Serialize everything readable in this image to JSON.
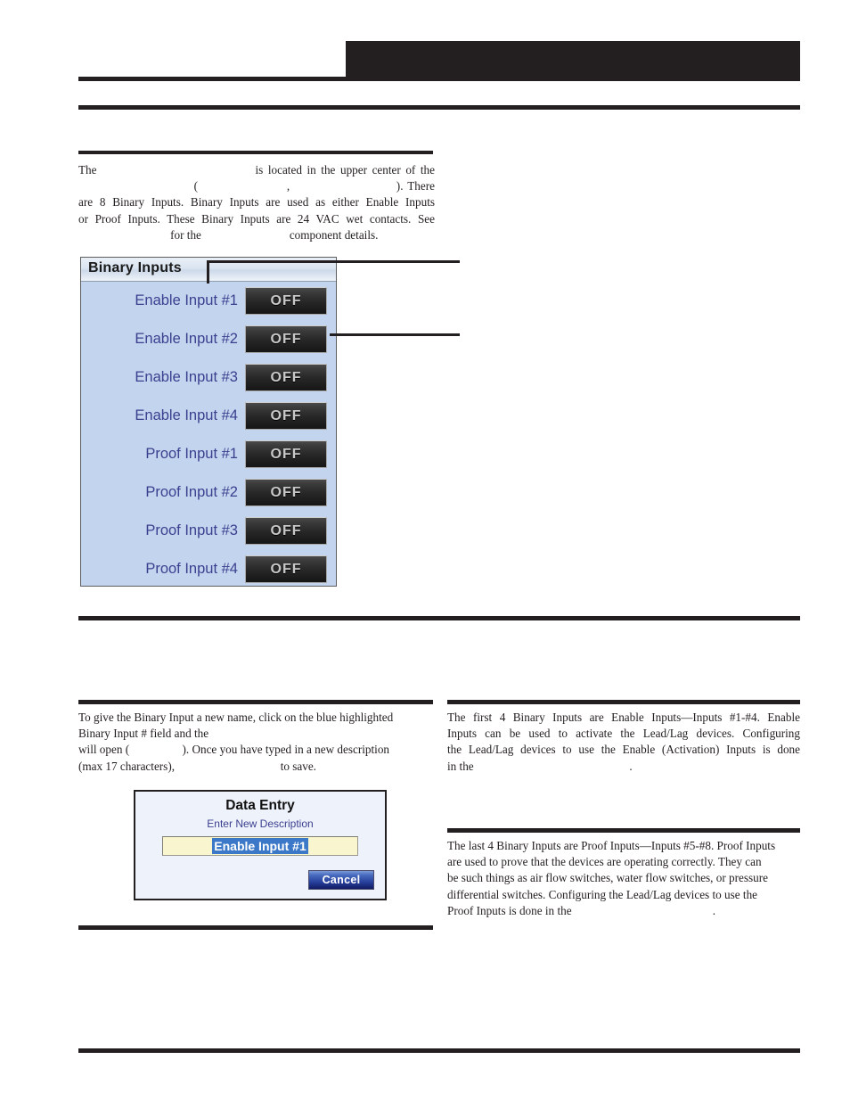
{
  "document": {
    "header": {
      "banner_block": "",
      "rules": [
        "header-rule",
        "section-rule"
      ]
    },
    "intro": {
      "lines": [
        "The                                is located in the upper center of the",
        "                          (                    ,                        ). There",
        "are 8 Binary Inputs. Binary Inputs are used as either Enable Inputs",
        "or Proof Inputs. These Binary Inputs are 24 VAC wet contacts. See",
        "            for the                              component details."
      ],
      "full_text": "The is located in the upper center of the ( , ). There are 8 Binary Inputs. Binary Inputs are used as either Enable Inputs or Proof Inputs. These Binary Inputs are 24 VAC wet contacts. See for the component details."
    },
    "binary_inputs_panel": {
      "title": "Binary Inputs",
      "rows": [
        {
          "label": "Enable Input #1",
          "state": "OFF"
        },
        {
          "label": "Enable Input #2",
          "state": "OFF"
        },
        {
          "label": "Enable Input #3",
          "state": "OFF"
        },
        {
          "label": "Enable Input #4",
          "state": "OFF"
        },
        {
          "label": "Proof Input #1",
          "state": "OFF"
        },
        {
          "label": "Proof Input #2",
          "state": "OFF"
        },
        {
          "label": "Proof Input #3",
          "state": "OFF"
        },
        {
          "label": "Proof Input #4",
          "state": "OFF"
        }
      ],
      "colors": {
        "panel_background": "#c3d5ee",
        "label_text": "#3b3f8f",
        "button_text": "#c8c8c8",
        "button_background_top": "#4a4a4a",
        "button_background_bottom": "#161616",
        "border": "#5d5d5d"
      }
    },
    "left_column": {
      "lines": [
        "To give the Binary Input a new name, click on the blue highlighted",
        "Binary Input # field and the",
        "will open (                  ). Once you have typed in a new description",
        "(max 17 characters),                                    to save."
      ],
      "full_text": "To give the Binary Input a new name, click on the blue highlighted Binary Input # field and the will open ( ). Once you have typed in a new description (max 17 characters), to save."
    },
    "data_entry_dialog": {
      "title": "Data Entry",
      "subtitle": "Enter New Description",
      "input_value": "Enable Input #1",
      "input_selected": true,
      "cancel_label": "Cancel",
      "colors": {
        "dialog_background": "#eef2fb",
        "input_background": "#f9f6cf",
        "selection_background": "#3c78c8",
        "cancel_button_top": "#7b9ad8",
        "cancel_button_bottom": "#101c63",
        "subtitle_text": "#3b3f8f"
      }
    },
    "right_column_top": {
      "lines": [
        "The first 4 Binary Inputs are Enable Inputs—Inputs #1-#4. Enable",
        "Inputs can be used to activate the Lead/Lag devices. Configuring",
        "the Lead/Lag devices to use the Enable (Activation) Inputs is done",
        "in the                                                     ."
      ],
      "full_text": "The first 4 Binary Inputs are Enable Inputs—Inputs #1-#4. Enable Inputs can be used to activate the Lead/Lag devices. Configuring the Lead/Lag devices to use the Enable (Activation) Inputs is done in the ."
    },
    "right_column_bottom": {
      "lines": [
        "The last 4 Binary Inputs are Proof Inputs—Inputs #5-#8. Proof Inputs",
        "are used to prove that the devices are operating correctly. They can",
        "be such things as air flow switches, water flow switches, or pressure",
        "differential switches. Configuring the Lead/Lag devices to use the",
        "Proof Inputs is done in the                                                ."
      ],
      "full_text": "The last 4 Binary Inputs are Proof Inputs—Inputs #5-#8. Proof Inputs are used to prove that the devices are operating correctly. They can be such things as air flow switches, water flow switches, or pressure differential switches. Configuring the Lead/Lag devices to use the Proof Inputs is done in the ."
    }
  }
}
